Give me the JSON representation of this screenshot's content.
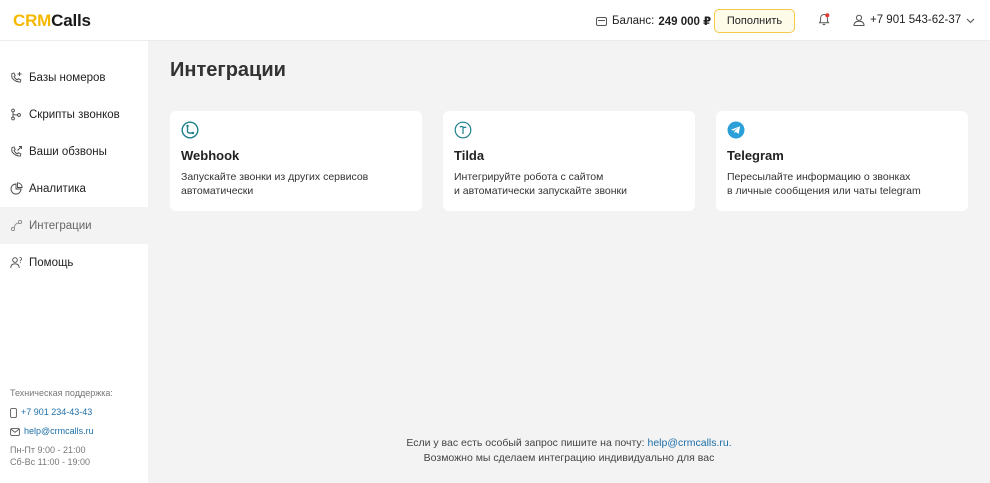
{
  "header": {
    "logo_part1": "CRM",
    "logo_part2": "Calls",
    "balance_label": "Баланс:",
    "balance_value": "249 000 ₽",
    "topup_label": "Пополнить",
    "user_phone": "+7 901 543-62-37"
  },
  "sidebar": {
    "items": [
      {
        "label": "Базы номеров",
        "icon": "phone-plus-icon"
      },
      {
        "label": "Скрипты звонков",
        "icon": "script-icon"
      },
      {
        "label": "Ваши обзвоны",
        "icon": "phone-out-icon"
      },
      {
        "label": "Аналитика",
        "icon": "analytics-icon"
      },
      {
        "label": "Интеграции",
        "icon": "integration-icon"
      },
      {
        "label": "Помощь",
        "icon": "help-icon"
      }
    ],
    "active_index": 4,
    "support": {
      "title": "Техническая поддержка:",
      "phone": "+7 901 234-43-43",
      "email": "help@crmcalls.ru",
      "hours_weekdays": "Пн-Пт 9:00 - 21:00",
      "hours_weekend": "Сб-Вс 11:00 - 19:00"
    }
  },
  "main": {
    "title": "Интеграции",
    "cards": [
      {
        "title": "Webhook",
        "description": "Запускайте звонки из других сервисов\nавтоматически",
        "icon": "webhook-icon"
      },
      {
        "title": "Tilda",
        "description": "Интегрируйте робота с сайтом\nи автоматически запускайте звонки",
        "icon": "tilda-icon"
      },
      {
        "title": "Telegram",
        "description": "Пересылайте информацию о звонках\nв личные сообщения или чаты telegram",
        "icon": "telegram-icon"
      }
    ],
    "footer_text": "Если у вас есть особый запрос пишите на почту:",
    "footer_email": "help@crmcalls.ru.",
    "footer_text2": "Возможно мы сделаем интеграцию индивидуально для вас"
  },
  "colors": {
    "brand_yellow": "#f5b800",
    "link_blue": "#1e6fa8",
    "icon_teal": "#1e7f8a",
    "telegram_blue": "#2a9fd8",
    "bell_red": "#e53935"
  }
}
